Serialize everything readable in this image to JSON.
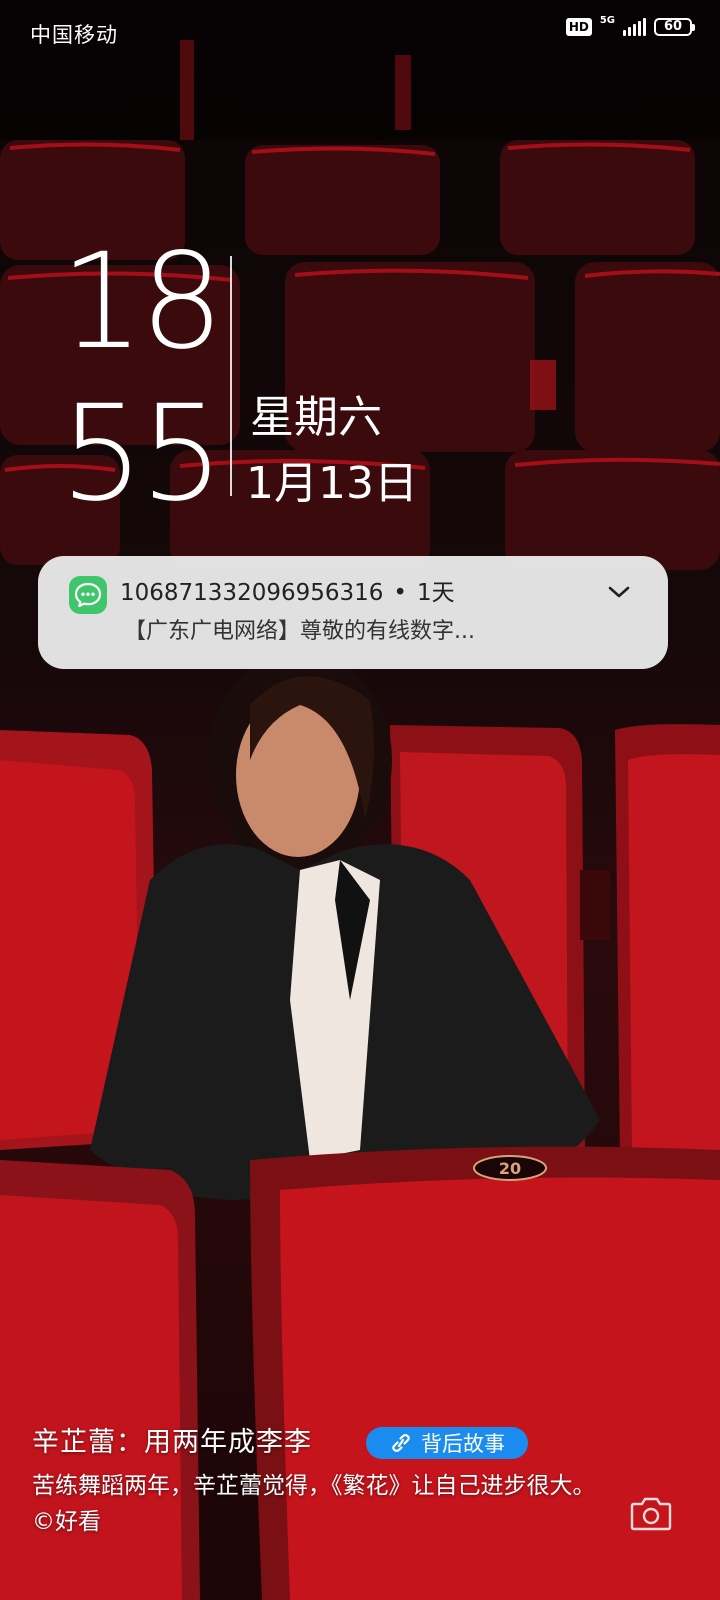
{
  "status_bar": {
    "carrier": "中国移动",
    "hd": "HD",
    "network": "5G",
    "battery": "60"
  },
  "clock": {
    "hours": "18",
    "minutes": "55",
    "weekday": "星期六",
    "date": "1月13日"
  },
  "notification": {
    "app_icon": "message-bubble-icon",
    "sender": "106871332096956316",
    "separator": "•",
    "time": "1天",
    "body": "【广东广电网络】尊敬的有线数字..."
  },
  "caption": {
    "title": "辛芷蕾：用两年成李李",
    "story_button": "背后故事",
    "description": "苦练舞蹈两年，辛芷蕾觉得，《繁花》让自己进步很大。©好看"
  },
  "colors": {
    "notification_bg": "#ececec",
    "message_icon": "#3fc56b",
    "story_button": "#1a8cf0",
    "seat_red": "#c4141c"
  }
}
